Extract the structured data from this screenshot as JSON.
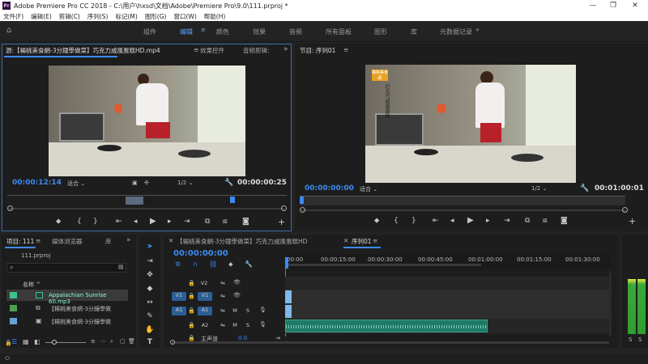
{
  "app": {
    "title": "Adobe Premiere Pro CC 2018 - C:\\用户\\hxsd\\文档\\Adobe\\Premiere Pro\\9.0\\111.prproj *",
    "icon_text": "Pr"
  },
  "menu": [
    "文件(F)",
    "编辑(E)",
    "剪辑(C)",
    "序列(S)",
    "标记(M)",
    "图形(G)",
    "窗口(W)",
    "帮助(H)"
  ],
  "workspaces": [
    "组件",
    "编辑",
    "颜色",
    "效果",
    "音频",
    "所有面板",
    "图形",
    "库",
    "元数据记录"
  ],
  "source_panel": {
    "tab_source": "源:【楊桃美食網-3分鐘學做菜】巧克力戚風蛋糕HD.mp4",
    "tab_effects": "效果控件",
    "tab_audio": "音频剪辑:",
    "timecode_in": "00:00:12:14",
    "fit": "适合",
    "resolution": "1/2",
    "timecode_dur": "00:00:00:25"
  },
  "program_panel": {
    "tab": "节目: 序列01",
    "timecode_in": "00:00:00:00",
    "fit": "适合",
    "resolution": "1/2",
    "timecode_dur": "00:01:00:01",
    "overlay_logo": "楊桃美食網",
    "overlay_text": "巧克力戚風蛋糕"
  },
  "project_panel": {
    "tab_project": "项目: 111",
    "tab_media": "媒体浏览器",
    "tab_lib": "库",
    "file": "111.prproj",
    "col_name": "名称",
    "items": [
      {
        "label": "Appalachian Sunrise 60.mp3",
        "color": "#3cc48a"
      },
      {
        "label": "【楊桃美食網-3分鐘學做",
        "color": "#4ea04e"
      },
      {
        "label": "【楊桃美食網-3分鐘學做",
        "color": "#6aa0d8"
      }
    ]
  },
  "timeline": {
    "tab_clip": "【楊桃美食網-3分鐘學做菜】巧克力戚風蛋糕HD",
    "tab_seq": "序列01",
    "timecode": "00:00:00:00",
    "ruler": [
      "00:00",
      "00:00:15:00",
      "00:00:30:00",
      "00:00:45:00",
      "00:01:00:00",
      "00:01:15:00",
      "00:01:30:00"
    ],
    "tracks": {
      "v2": "V2",
      "v1": "V1",
      "a1": "A1",
      "a2": "A2",
      "m": "M",
      "s": "S",
      "master": "主声道",
      "master_val": "0.0"
    },
    "src_v1": "V1",
    "src_a1": "A1"
  },
  "meters": {
    "s1": "S",
    "s2": "S"
  },
  "colors": {
    "accent": "#3c8bf0",
    "audio_clip": "#1f7a66",
    "video_clip": "#7fb8e8"
  }
}
